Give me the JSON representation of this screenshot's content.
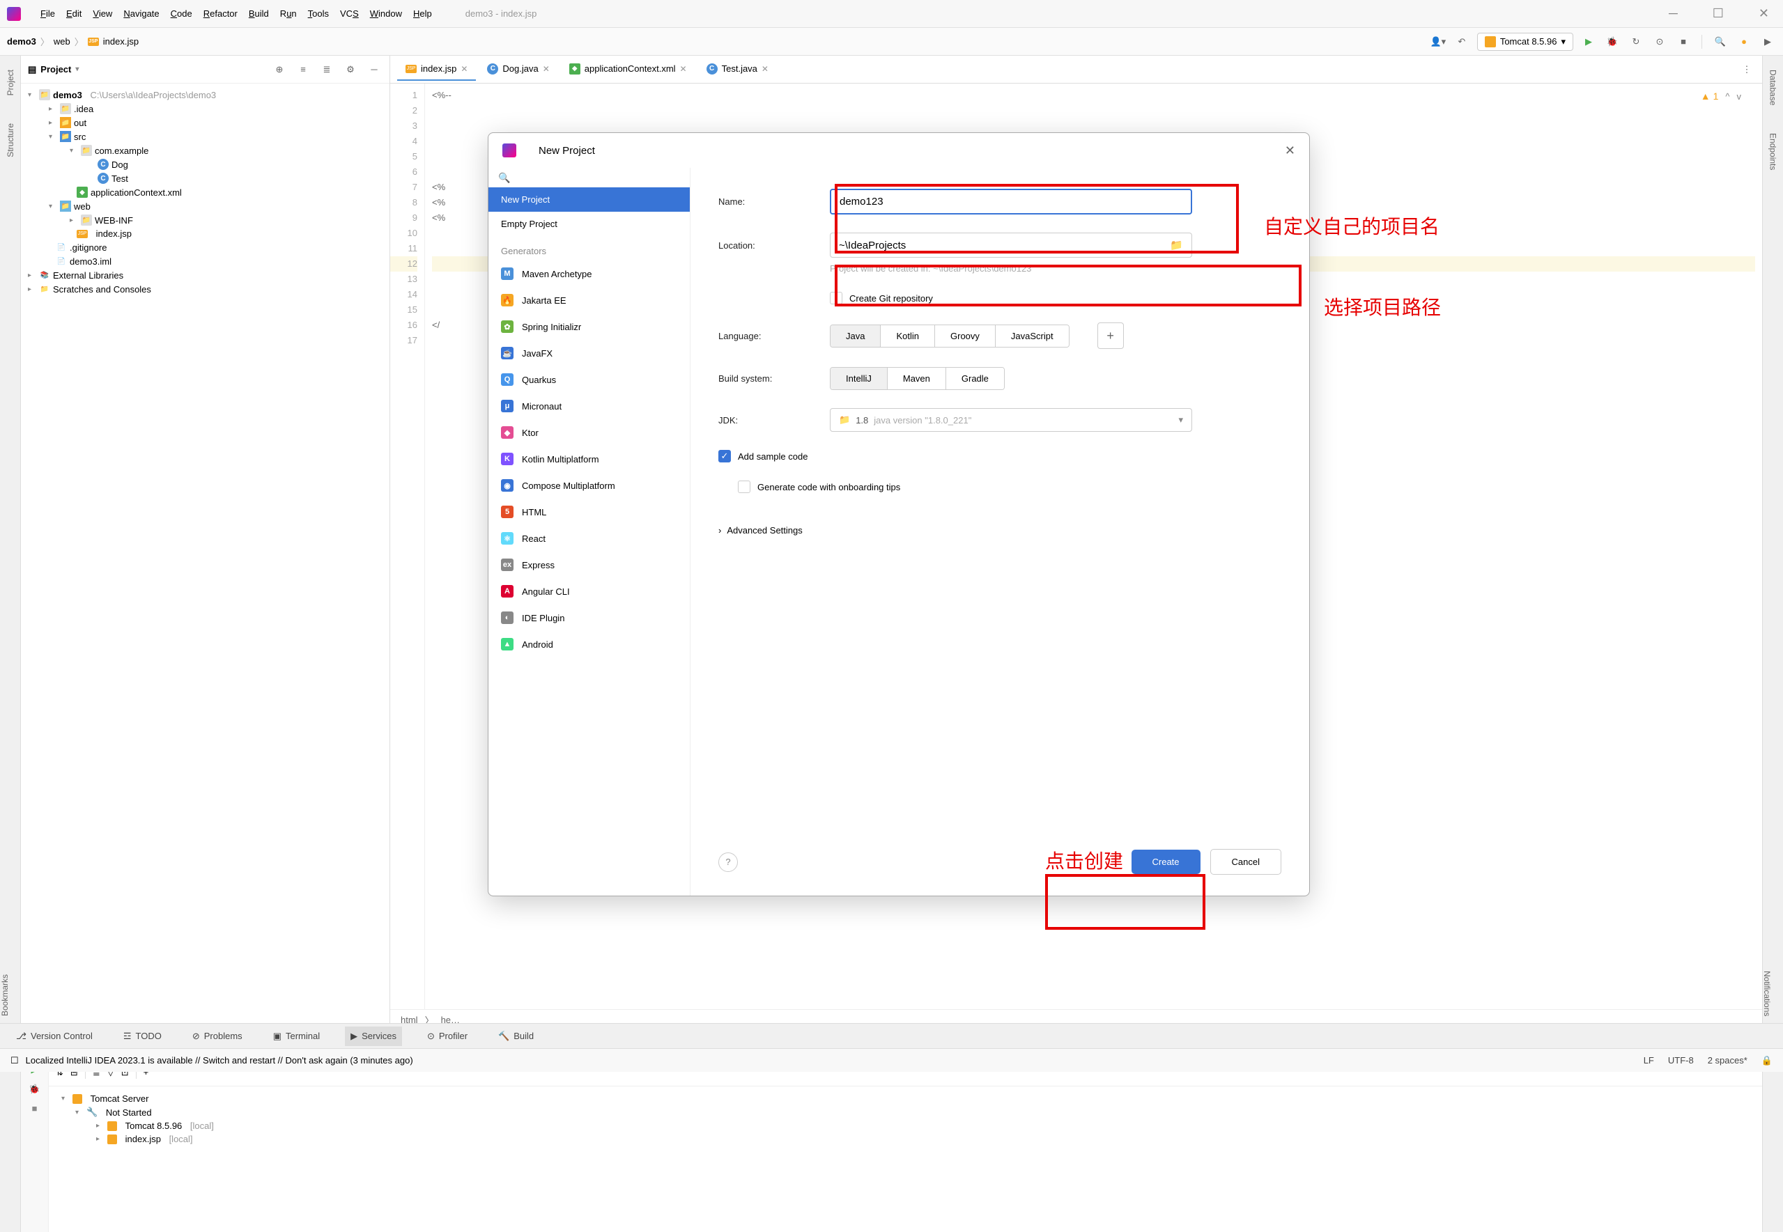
{
  "window": {
    "title": "demo3 - index.jsp",
    "menu": [
      "File",
      "Edit",
      "View",
      "Navigate",
      "Code",
      "Refactor",
      "Build",
      "Run",
      "Tools",
      "VCS",
      "Window",
      "Help"
    ]
  },
  "breadcrumb": {
    "root": "demo3",
    "mid": "web",
    "file": "index.jsp"
  },
  "run_config": "Tomcat 8.5.96",
  "project_panel": {
    "title": "Project",
    "tree": {
      "root": "demo3",
      "root_path": "C:\\Users\\a\\IdeaProjects\\demo3",
      "idea": ".idea",
      "out": "out",
      "src": "src",
      "pkg": "com.example",
      "cls1": "Dog",
      "cls2": "Test",
      "appctx": "applicationContext.xml",
      "web": "web",
      "webinf": "WEB-INF",
      "indexjsp": "index.jsp",
      "gitignore": ".gitignore",
      "iml": "demo3.iml",
      "ext": "External Libraries",
      "scratch": "Scratches and Consoles"
    }
  },
  "tabs": [
    {
      "label": "index.jsp",
      "icon": "jsp",
      "active": true
    },
    {
      "label": "Dog.java",
      "icon": "c"
    },
    {
      "label": "applicationContext.xml",
      "icon": "xml"
    },
    {
      "label": "Test.java",
      "icon": "c"
    }
  ],
  "editor": {
    "lines": [
      "1",
      "2",
      "3",
      "4",
      "5",
      "6",
      "7",
      "8",
      "9",
      "10",
      "11",
      "12",
      "13",
      "14",
      "15",
      "16",
      "17"
    ],
    "code_snips": {
      "1": "<%--",
      "7": "<%",
      "8": "<%",
      "9": "<%",
      "16": "</"
    },
    "warn_count": "1",
    "statusbar": {
      "html": "html",
      "he": "he…"
    }
  },
  "services": {
    "title": "Services",
    "server": "Tomcat Server",
    "notstarted": "Not Started",
    "tomcat": "Tomcat 8.5.96",
    "tomcat_suffix": "[local]",
    "indexjsp": "index.jsp",
    "indexjsp_suffix": "[local]"
  },
  "bottom_tabs": {
    "vc": "Version Control",
    "todo": "TODO",
    "problems": "Problems",
    "terminal": "Terminal",
    "services": "Services",
    "profiler": "Profiler",
    "build": "Build"
  },
  "status_bar": {
    "msg": "Localized IntelliJ IDEA 2023.1 is available // Switch and restart // Don't ask again (3 minutes ago)",
    "lf": "LF",
    "enc": "UTF-8",
    "spaces": "2 spaces*"
  },
  "left_gutter": {
    "project": "Project",
    "structure": "Structure",
    "bookmarks": "Bookmarks"
  },
  "right_gutter": {
    "database": "Database",
    "endpoints": "Endpoints",
    "notifications": "Notifications"
  },
  "dialog": {
    "title": "New Project",
    "search_placeholder": "",
    "left": {
      "new_project": "New Project",
      "empty_project": "Empty Project",
      "generators_header": "Generators",
      "generators": [
        {
          "label": "Maven Archetype",
          "color": "#4a90d9",
          "glyph": "M"
        },
        {
          "label": "Jakarta EE",
          "color": "#f5a623",
          "glyph": "🔥"
        },
        {
          "label": "Spring Initializr",
          "color": "#6db33f",
          "glyph": "✿"
        },
        {
          "label": "JavaFX",
          "color": "#3874d6",
          "glyph": "☕"
        },
        {
          "label": "Quarkus",
          "color": "#4695eb",
          "glyph": "Q"
        },
        {
          "label": "Micronaut",
          "color": "#3874d6",
          "glyph": "μ"
        },
        {
          "label": "Ktor",
          "color": "#e44d93",
          "glyph": "◆"
        },
        {
          "label": "Kotlin Multiplatform",
          "color": "#7f52ff",
          "glyph": "K"
        },
        {
          "label": "Compose Multiplatform",
          "color": "#3874d6",
          "glyph": "◉"
        },
        {
          "label": "HTML",
          "color": "#e44d26",
          "glyph": "5"
        },
        {
          "label": "React",
          "color": "#61dafb",
          "glyph": "⚛"
        },
        {
          "label": "Express",
          "color": "#888",
          "glyph": "ex"
        },
        {
          "label": "Angular CLI",
          "color": "#dd0031",
          "glyph": "A"
        },
        {
          "label": "IDE Plugin",
          "color": "#888",
          "glyph": "◐"
        },
        {
          "label": "Android",
          "color": "#3ddc84",
          "glyph": "▲"
        }
      ]
    },
    "form": {
      "name_label": "Name:",
      "name_value": "demo123",
      "location_label": "Location:",
      "location_value": "~\\IdeaProjects",
      "location_hint": "Project will be created in: ~\\IdeaProjects\\demo123",
      "git_label": "Create Git repository",
      "language_label": "Language:",
      "languages": [
        "Java",
        "Kotlin",
        "Groovy",
        "JavaScript"
      ],
      "build_label": "Build system:",
      "builds": [
        "IntelliJ",
        "Maven",
        "Gradle"
      ],
      "jdk_label": "JDK:",
      "jdk_value": "1.8",
      "jdk_detail": "java version \"1.8.0_221\"",
      "sample_label": "Add sample code",
      "onboard_label": "Generate code with onboarding tips",
      "advanced": "Advanced Settings",
      "create": "Create",
      "cancel": "Cancel"
    }
  },
  "annotations": {
    "name": "自定义自己的项目名",
    "path": "选择项目路径",
    "create": "点击创建"
  }
}
